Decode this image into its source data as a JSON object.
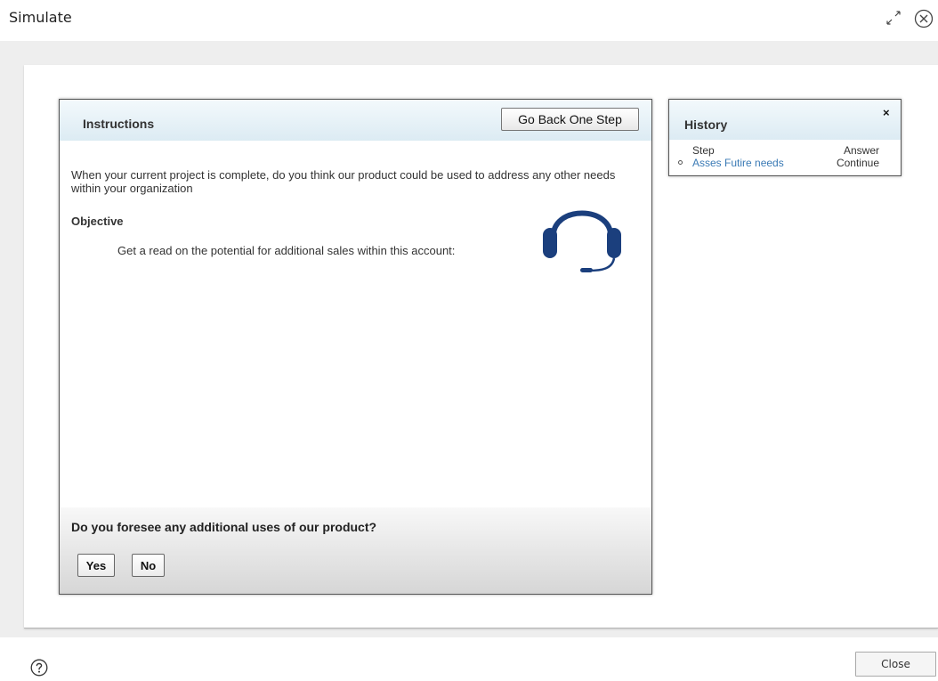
{
  "dialog": {
    "title": "Simulate",
    "expand_icon": "expand-icon",
    "close_icon": "close-circle-icon"
  },
  "instructions": {
    "title": "Instructions",
    "back_button": "Go Back One Step",
    "text": "When your current project is complete, do you think our product could be used to address any other needs within your organization",
    "objective_label": "Objective",
    "objective_text": "Get a read on the potential for additional sales within this account:",
    "icon": "headset-icon",
    "question": "Do you foresee any additional uses of our product?",
    "answers": [
      "Yes",
      "No"
    ]
  },
  "history": {
    "title": "History",
    "close_label": "×",
    "columns": {
      "step": "Step",
      "answer": "Answer"
    },
    "rows": [
      {
        "step": "Asses Futire needs",
        "answer": "Continue"
      }
    ]
  },
  "footer": {
    "help_icon": "help-circle-icon",
    "close_button": "Close"
  },
  "colors": {
    "header_gradient_top": "#f3f9fc",
    "header_gradient_bottom": "#dcebf3",
    "headset_blue": "#1b3f7d",
    "link_blue": "#3a7ab5",
    "frame_grey": "#eeeeee"
  }
}
